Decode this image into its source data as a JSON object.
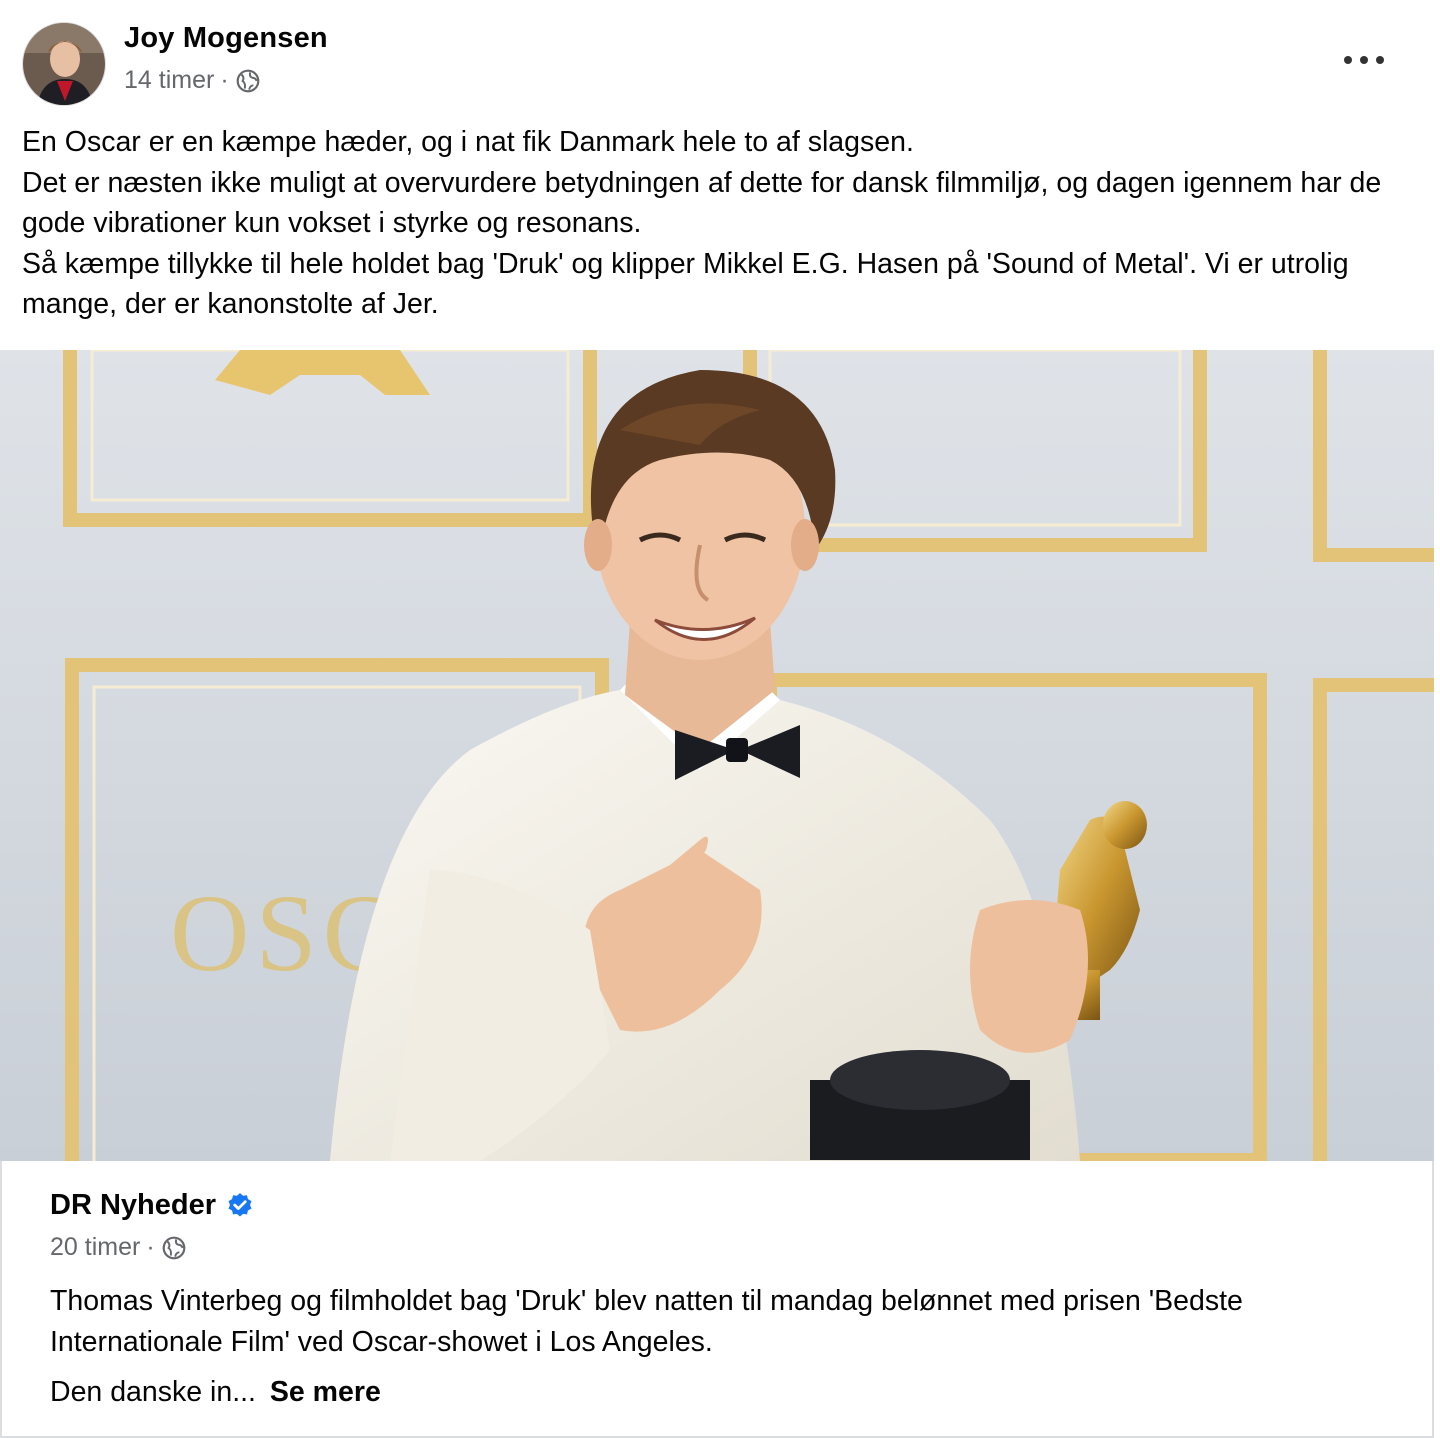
{
  "post": {
    "author": "Joy Mogensen",
    "time": "14 timer",
    "separator": "·",
    "privacy_icon": "globe-icon",
    "more_icon": "more-horizontal-icon",
    "text_lines": [
      "En Oscar er en kæmpe hæder, og i nat fik Danmark hele to af slagsen.",
      "Det er næsten ikke muligt at overvurdere betydningen af dette for dansk filmmiljø, og dagen igennem har de gode vibrationer kun vokset i styrke og resonans.",
      "Så kæmpe tillykke til hele holdet bag 'Druk' og klipper Mikkel E.G. Hasen på 'Sound of Metal'. Vi er utrolig mange, der er kanonstolte af Jer."
    ],
    "photo_sign_text": "OSCA"
  },
  "shared": {
    "author": "DR Nyheder",
    "verified_icon": "verified-badge-icon",
    "time": "20 timer",
    "separator": "·",
    "text": "Thomas Vinterbeg og filmholdet bag 'Druk' blev natten til mandag belønnet med prisen 'Bedste Internationale Film' ved Oscar-showet i Los Angeles.",
    "truncated": "Den danske in...",
    "see_more": "Se mere"
  },
  "colors": {
    "text": "#050505",
    "secondary": "#65676b",
    "verified": "#1877f2",
    "gold": "#d9b45a"
  }
}
